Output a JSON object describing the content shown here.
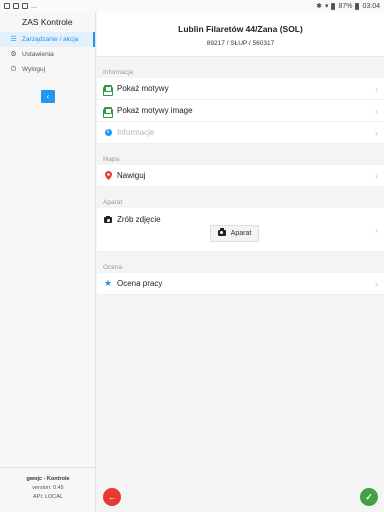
{
  "status_bar": {
    "left_text": "...",
    "battery": "87%",
    "time": "03:04"
  },
  "sidebar": {
    "app_title": "ZAS Kontrole",
    "items": [
      {
        "label": "Zarządzanie / akcja",
        "icon": "list-icon",
        "active": true
      },
      {
        "label": "Ustawienia",
        "icon": "gear-icon",
        "active": false
      },
      {
        "label": "Wyloguj",
        "icon": "logout-icon",
        "active": false
      }
    ],
    "collapse_icon": "chevron-left-icon",
    "footer": {
      "name": "gwojc - Kontrole",
      "version": "version: 0.45",
      "api": "API: LOCAL"
    }
  },
  "header": {
    "title": "Lublin Filaretów 44/Zana (SOL)",
    "subtitle": "89217 / SŁUP / 560317"
  },
  "sections": {
    "informacje": {
      "label": "Informacje",
      "rows": [
        {
          "label": "Pokaż motywy",
          "icon": "image-icon"
        },
        {
          "label": "Pokaż motywy image",
          "icon": "image-icon"
        },
        {
          "label": "Informacje",
          "icon": "info-icon",
          "disabled": true
        }
      ]
    },
    "mapa": {
      "label": "Mapa",
      "rows": [
        {
          "label": "Nawiguj",
          "icon": "map-pin-icon"
        }
      ]
    },
    "aparat": {
      "label": "Aparat",
      "rows": [
        {
          "label": "Zrób zdjęcie",
          "icon": "camera-icon"
        }
      ],
      "button_label": "Aparat"
    },
    "ocena": {
      "label": "Ocena",
      "rows": [
        {
          "label": "Ocena pracy",
          "icon": "star-icon"
        }
      ]
    }
  },
  "colors": {
    "accent": "#2196f3",
    "back_fab": "#e53935",
    "ok_fab": "#43a047"
  }
}
